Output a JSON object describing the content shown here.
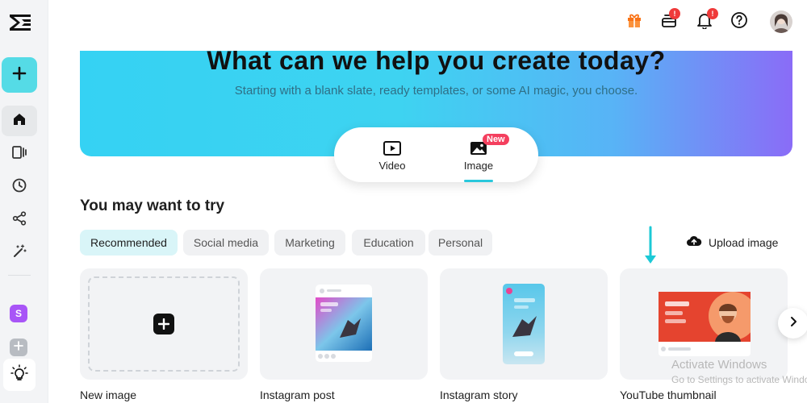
{
  "sidebar": {
    "space_initial": "S"
  },
  "topbar": {
    "cart_badge": "!",
    "notification_badge": "!"
  },
  "banner": {
    "title": "What can we help you create today?",
    "subtitle": "Starting with a blank slate, ready templates, or some AI magic, you choose."
  },
  "switcher": {
    "video_label": "Video",
    "image_label": "Image",
    "new_badge": "New"
  },
  "section": {
    "title": "You may want to try",
    "filters": [
      "Recommended",
      "Social media",
      "Marketing",
      "Education",
      "Personal"
    ],
    "upload_label": "Upload image"
  },
  "cards": [
    {
      "label": "New image"
    },
    {
      "label": "Instagram post"
    },
    {
      "label": "Instagram story"
    },
    {
      "label": "YouTube thumbnail"
    }
  ],
  "watermark": {
    "line1": "Activate Windows",
    "line2": "Go to Settings to activate Windows."
  },
  "colors": {
    "accent": "#55dbe6",
    "banner_start": "#35d2f3",
    "banner_end": "#8a6cf7",
    "badge_red": "#ef3a3a",
    "active_chip": "#d9f5f8"
  }
}
